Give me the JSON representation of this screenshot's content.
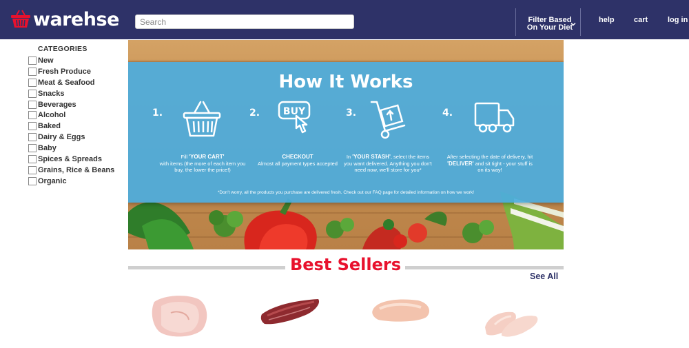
{
  "header": {
    "logo_text": "warehse",
    "search_placeholder": "Search",
    "filter_line1": "Filter Based",
    "filter_line2": "On Your Diet",
    "nav": [
      "help",
      "cart",
      "log in"
    ],
    "bg_color": "#2e3268"
  },
  "sidebar": {
    "title": "CATEGORIES",
    "items": [
      "New",
      "Fresh Produce",
      "Meat & Seafood",
      "Snacks",
      "Beverages",
      "Alcohol",
      "Baked",
      "Dairy & Eggs",
      "Baby",
      "Spices & Spreads",
      "Grains, Rice & Beans",
      "Organic"
    ]
  },
  "hero": {
    "title": "How It Works",
    "panel_color": "#4cadde",
    "steps": [
      {
        "num": "1.",
        "icon": "basket-icon",
        "lead": "Fill ",
        "key": "'YOUR CART'",
        "text": "with items (the more of each item you buy, the lower the price!)"
      },
      {
        "num": "2.",
        "icon": "buy-button-icon",
        "lead": "",
        "key": "CHECKOUT",
        "text": "Almost all payment types accepted"
      },
      {
        "num": "3.",
        "icon": "hand-truck-icon",
        "lead": "In ",
        "key": "'YOUR STASH'",
        "text": ", select the items you want delivered. Anything you don't need now, we'll store for you*"
      },
      {
        "num": "4.",
        "icon": "delivery-truck-icon",
        "lead": "After selecting the date of delivery, hit ",
        "key": "'DELIVER'",
        "text": " and sit tight - your stuff is on its way!"
      }
    ],
    "note": "*Don't worry, all the products you purchase are delivered fresh. Check out our FAQ page for detailed information on how we work!"
  },
  "best_sellers": {
    "title": "Best Sellers",
    "see_all": "See All",
    "accent_color": "#e8112d",
    "products": [
      "chicken-thigh-image",
      "beef-steak-image",
      "chicken-breast-image",
      "chicken-tenders-image"
    ]
  }
}
